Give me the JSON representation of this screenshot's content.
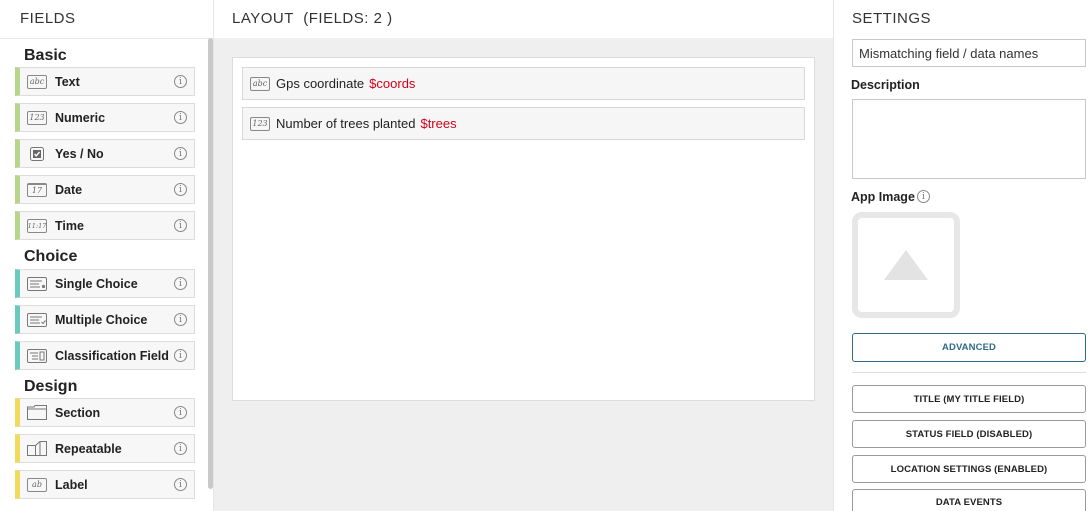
{
  "fields_panel": {
    "title": "FIELDS",
    "groups": [
      {
        "title": "Basic",
        "items": [
          {
            "label": "Text",
            "icon": "text-field-icon",
            "icon_text": "abc"
          },
          {
            "label": "Numeric",
            "icon": "numeric-field-icon",
            "icon_text": "123"
          },
          {
            "label": "Yes / No",
            "icon": "checkbox-icon"
          },
          {
            "label": "Date",
            "icon": "calendar-icon",
            "icon_text": "17"
          },
          {
            "label": "Time",
            "icon": "clock-icon",
            "icon_text": "11:17"
          }
        ]
      },
      {
        "title": "Choice",
        "items": [
          {
            "label": "Single Choice",
            "icon": "single-choice-icon"
          },
          {
            "label": "Multiple Choice",
            "icon": "multiple-choice-icon"
          },
          {
            "label": "Classification Field",
            "icon": "classification-icon"
          }
        ]
      },
      {
        "title": "Design",
        "items": [
          {
            "label": "Section",
            "icon": "folder-icon"
          },
          {
            "label": "Repeatable",
            "icon": "repeatable-icon"
          },
          {
            "label": "Label",
            "icon": "label-icon",
            "icon_text": "ab"
          }
        ]
      }
    ],
    "info_glyph": "i"
  },
  "layout_panel": {
    "title": "LAYOUT",
    "count_text": "(FIELDS: 2 )",
    "rows": [
      {
        "label": "Gps coordinate",
        "variable": "$coords",
        "icon": "text-field-icon",
        "icon_text": "abc"
      },
      {
        "label": "Number of trees planted",
        "variable": "$trees",
        "icon": "numeric-field-icon",
        "icon_text": "123"
      }
    ]
  },
  "settings_panel": {
    "title": "SETTINGS",
    "name_value": "Mismatching field / data names",
    "description_label": "Description",
    "description_value": "",
    "app_image_label": "App Image",
    "advanced_label": "ADVANCED",
    "buttons": [
      "TITLE (MY TITLE FIELD)",
      "STATUS FIELD (DISABLED)",
      "LOCATION SETTINGS (ENABLED)",
      "DATA EVENTS"
    ]
  },
  "colors": {
    "basic": "#b8d68a",
    "choice": "#6cc9bd",
    "design": "#f0dc5a",
    "variable": "#d0021b",
    "advanced": "#2f6a8a"
  }
}
